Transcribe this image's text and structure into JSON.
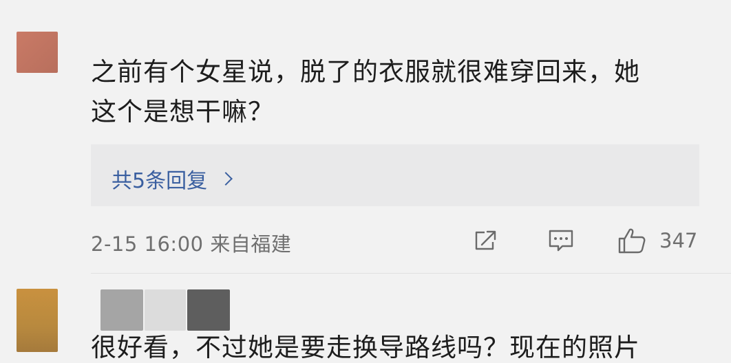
{
  "comments": [
    {
      "text_line1": "之前有个女星说，脱了的衣服就很难穿回来，她",
      "text_line2": "这个是想干嘛？",
      "replies_label": "共5条回复",
      "meta": "2-15 16:00 来自福建",
      "like_count": "347",
      "avatar_color": "#c47866"
    },
    {
      "text_partial": "很好看，不过她是要走换导路线吗？现在的照片",
      "avatar_color": "#c08d40"
    }
  ],
  "colors": {
    "background": "#f2f2f2",
    "link": "#3a5fa0",
    "meta": "#6f6f6f",
    "reply_box": "#e9e9ea"
  },
  "icons": [
    "share-icon",
    "comment-icon",
    "like-icon",
    "chevron-right-icon"
  ]
}
